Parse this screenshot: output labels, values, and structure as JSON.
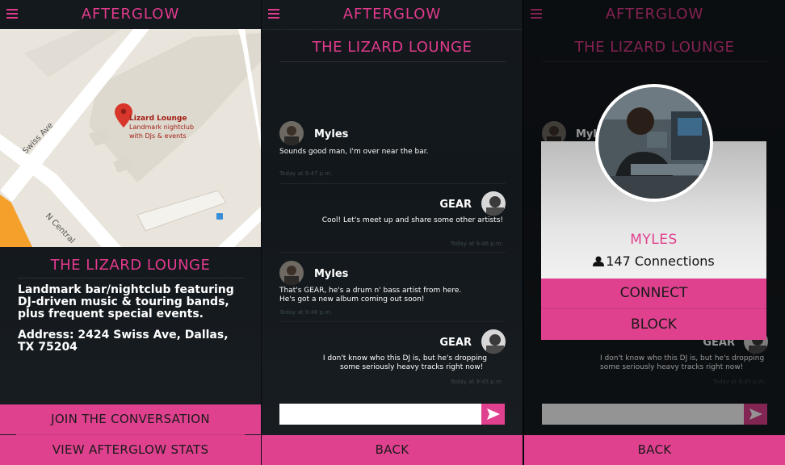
{
  "app": {
    "brand": "AFTERGLOW"
  },
  "panel1": {
    "map": {
      "street_1": "Swiss Ave",
      "street_2": "N Central",
      "pin_title": "Lizard Lounge",
      "pin_subtitle_1": "Landmark nightclub",
      "pin_subtitle_2": "with DJs & events"
    },
    "venue_title": "THE LIZARD LOUNGE",
    "description": "Landmark bar/nightclub featuring DJ-driven music & touring bands, plus frequent special events.",
    "address": "Address: 2424 Swiss Ave, Dallas, TX 75204",
    "join_button": "JOIN THE CONVERSATION",
    "stats_button": "VIEW AFTERGLOW STATS"
  },
  "panel2": {
    "title": "THE LIZARD LOUNGE",
    "messages": [
      {
        "sender": "Myles",
        "text": "Sounds good man, I'm over near the bar.",
        "time": "Today at 9:47 p.m."
      },
      {
        "sender": "GEAR",
        "text": "Cool! Let's meet up and share some other artists!",
        "time": "Today at 9:46 p.m."
      },
      {
        "sender": "Myles",
        "text_1": "That's GEAR, he's a drum n' bass artist from here.",
        "text_2": "He's got a new album coming out soon!",
        "time": "Today at 9:46 p.m."
      },
      {
        "sender": "GEAR",
        "text_1": "I don't know who this DJ is, but he's dropping",
        "text_2": "some seriously heavy tracks right now!",
        "time": "Today at 9:45 p.m."
      }
    ],
    "back_button": "BACK"
  },
  "panel3": {
    "title": "THE LIZARD LOUNGE",
    "bg_sender_1": "Myl",
    "bg_sender_2": "GEAR",
    "bg_text_1": "I don't know who this DJ is, but he's dropping",
    "bg_text_2": "some seriously heavy tracks right now!",
    "bg_time": "Today at 9:45 p.m.",
    "profile": {
      "name": "MYLES",
      "connections": "147 Connections"
    },
    "connect_button": "CONNECT",
    "block_button": "BLOCK",
    "back_button": "BACK"
  },
  "colors": {
    "accent": "#e0418f",
    "brand_text": "#e23a8d",
    "background": "#14191d"
  }
}
